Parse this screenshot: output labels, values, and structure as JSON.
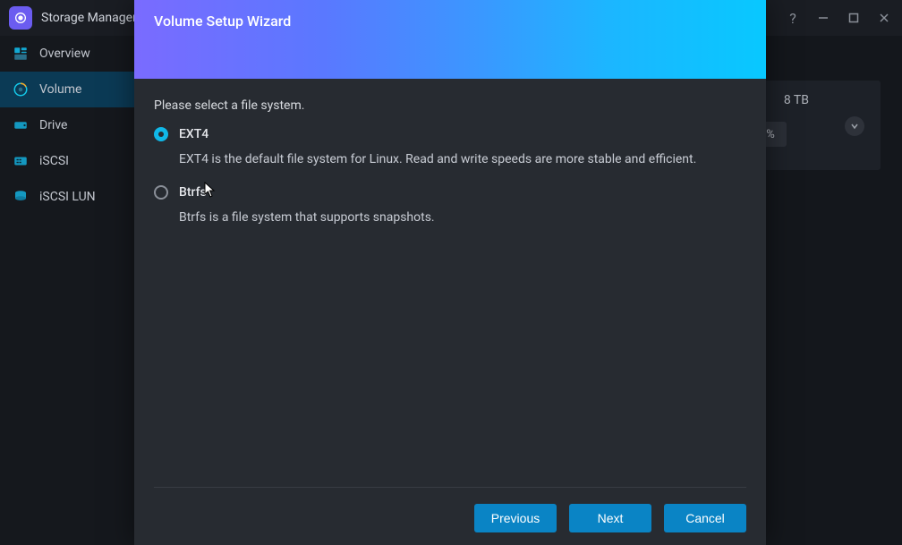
{
  "titlebar": {
    "app_title": "Storage Manager"
  },
  "sidebar": {
    "items": [
      {
        "label": "Overview"
      },
      {
        "label": "Volume"
      },
      {
        "label": "Drive"
      },
      {
        "label": "iSCSI"
      },
      {
        "label": "iSCSI LUN"
      }
    ]
  },
  "bg_card": {
    "size_text": "8 TB",
    "percent_text": "%"
  },
  "wizard": {
    "title": "Volume Setup Wizard",
    "prompt": "Please select a file system.",
    "options": [
      {
        "label": "EXT4",
        "desc": "EXT4 is the default file system for Linux. Read and write speeds are more stable and efficient."
      },
      {
        "label": "Btrfs",
        "desc": "Btrfs is a file system that supports snapshots."
      }
    ],
    "buttons": {
      "previous": "Previous",
      "next": "Next",
      "cancel": "Cancel"
    }
  }
}
